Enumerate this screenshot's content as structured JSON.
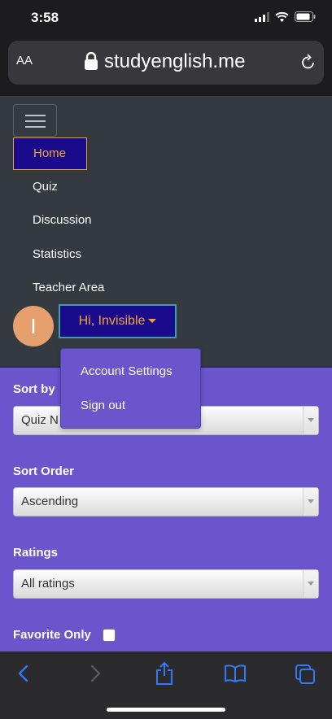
{
  "status": {
    "time": "3:58"
  },
  "browser": {
    "aa": "AA",
    "url": "studyenglish.me"
  },
  "nav": {
    "items": [
      {
        "label": "Home",
        "active": true
      },
      {
        "label": "Quiz"
      },
      {
        "label": "Discussion"
      },
      {
        "label": "Statistics"
      },
      {
        "label": "Teacher Area"
      }
    ],
    "avatar_letter": "I",
    "user_button": "Hi, Invisible"
  },
  "dropdown": {
    "items": [
      "Account Settings",
      "Sign out"
    ]
  },
  "filters": {
    "sort_by": {
      "label": "Sort by",
      "value": "Quiz N"
    },
    "sort_order": {
      "label": "Sort Order",
      "value": "Ascending"
    },
    "ratings": {
      "label": "Ratings",
      "value": "All ratings"
    },
    "favorite": {
      "label": "Favorite Only",
      "checked": false
    }
  },
  "colors": {
    "accent": "#f0a530",
    "purple": "#6a55cc",
    "nav_bg": "#343a40",
    "active_bg": "#1a0a8c",
    "ios_blue": "#3478f6"
  }
}
